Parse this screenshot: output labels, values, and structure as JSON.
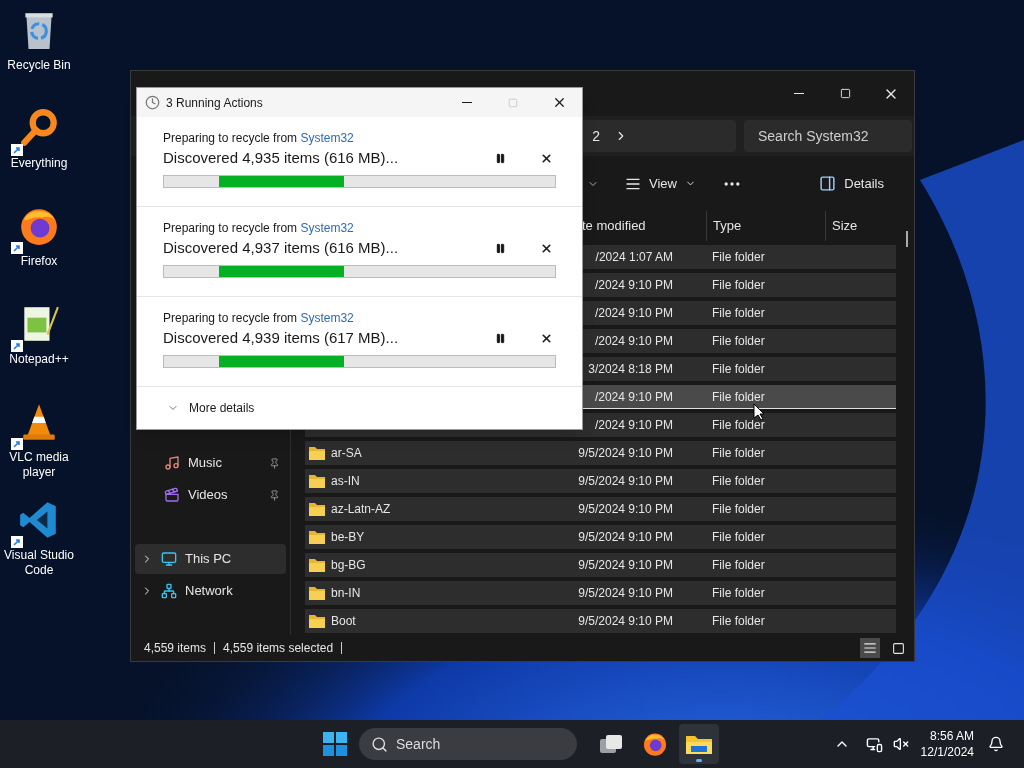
{
  "desktop": {
    "icons": [
      {
        "label": "Recycle Bin",
        "kind": "recycle",
        "shortcut": false
      },
      {
        "label": "Everything",
        "kind": "everything",
        "shortcut": true
      },
      {
        "label": "Firefox",
        "kind": "firefox",
        "shortcut": true
      },
      {
        "label": "Notepad++",
        "kind": "notepad",
        "shortcut": true
      },
      {
        "label": "VLC media player",
        "kind": "vlc",
        "shortcut": true
      },
      {
        "label": "Visual Studio Code",
        "kind": "vscode",
        "shortcut": true
      }
    ]
  },
  "explorer": {
    "address_tail": "2",
    "search": {
      "placeholder": "Search System32"
    },
    "toolbar": {
      "view": "View",
      "details": "Details",
      "details_on": false
    },
    "columns": [
      "te modified",
      "Type",
      "Size"
    ],
    "sidebar": [
      {
        "label": "Music",
        "kind": "music",
        "pinned": true,
        "selected": false,
        "expandable": false
      },
      {
        "label": "Videos",
        "kind": "videos",
        "pinned": true,
        "selected": false,
        "expandable": false
      },
      {
        "label": "This PC",
        "kind": "pc",
        "pinned": false,
        "selected": true,
        "expandable": true
      },
      {
        "label": "Network",
        "kind": "network",
        "pinned": false,
        "selected": false,
        "expandable": true
      }
    ],
    "rows": [
      {
        "date": "/2024 1:07 AM",
        "type": "File folder",
        "selected": true,
        "focused": false
      },
      {
        "date": "/2024 9:10 PM",
        "type": "File folder",
        "selected": true,
        "focused": false
      },
      {
        "date": "/2024 9:10 PM",
        "type": "File folder",
        "selected": true,
        "focused": false
      },
      {
        "date": "/2024 9:10 PM",
        "type": "File folder",
        "selected": true,
        "focused": false
      },
      {
        "date": "3/2024 8:18 PM",
        "type": "File folder",
        "selected": true,
        "focused": false
      },
      {
        "date": "/2024 9:10 PM",
        "type": "File folder",
        "selected": true,
        "focused": true
      },
      {
        "date": "/2024 9:10 PM",
        "type": "File folder",
        "selected": true,
        "focused": false
      },
      {
        "name": "ar-SA",
        "date": "9/5/2024 9:10 PM",
        "type": "File folder",
        "selected": true,
        "focused": false
      },
      {
        "name": "as-IN",
        "date": "9/5/2024 9:10 PM",
        "type": "File folder",
        "selected": true,
        "focused": false
      },
      {
        "name": "az-Latn-AZ",
        "date": "9/5/2024 9:10 PM",
        "type": "File folder",
        "selected": true,
        "focused": false
      },
      {
        "name": "be-BY",
        "date": "9/5/2024 9:10 PM",
        "type": "File folder",
        "selected": true,
        "focused": false
      },
      {
        "name": "bg-BG",
        "date": "9/5/2024 9:10 PM",
        "type": "File folder",
        "selected": true,
        "focused": false
      },
      {
        "name": "bn-IN",
        "date": "9/5/2024 9:10 PM",
        "type": "File folder",
        "selected": true,
        "focused": false
      },
      {
        "name": "Boot",
        "date": "9/5/2024 9:10 PM",
        "type": "File folder",
        "selected": true,
        "focused": false
      }
    ],
    "status_bar": {
      "count": "4,559 items",
      "selected": "4,559 items selected"
    },
    "details_view": true
  },
  "dialog": {
    "title": "3 Running Actions",
    "actions": [
      {
        "label": "Preparing to recycle from",
        "source": "System32",
        "progress": "Discovered 4,935 items (616 MB)...",
        "level": 0.32
      },
      {
        "label": "Preparing to recycle from",
        "source": "System32",
        "progress": "Discovered 4,937 items (616 MB)...",
        "level": 0.32
      },
      {
        "label": "Preparing to recycle from",
        "source": "System32",
        "progress": "Discovered 4,939 items (617 MB)...",
        "level": 0.32
      }
    ],
    "more_details": "More details"
  },
  "taskbar": {
    "search": {
      "placeholder": "Search"
    },
    "apps": [
      {
        "kind": "taskview",
        "active": false
      },
      {
        "kind": "firefox",
        "active": false
      },
      {
        "kind": "explorer",
        "active": true
      }
    ],
    "clock": {
      "time": "8:56 AM",
      "date": "12/1/2024"
    }
  }
}
